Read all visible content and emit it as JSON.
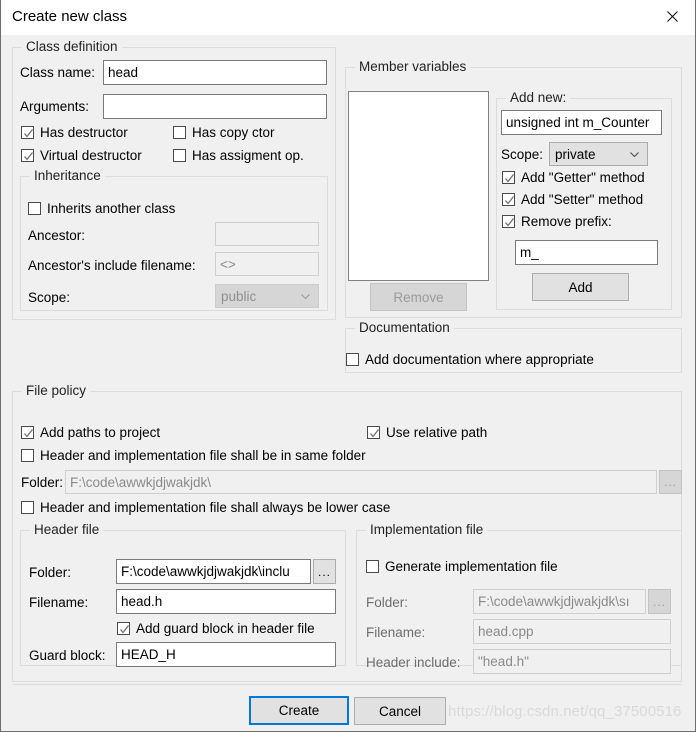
{
  "window": {
    "title": "Create new class",
    "close_icon": "close-icon"
  },
  "class_definition": {
    "legend": "Class definition",
    "class_name_label": "Class name:",
    "class_name_value": "head",
    "arguments_label": "Arguments:",
    "arguments_value": "",
    "has_destructor_label": "Has destructor",
    "has_destructor_checked": true,
    "has_copy_ctor_label": "Has copy ctor",
    "has_copy_ctor_checked": false,
    "virtual_destructor_label": "Virtual destructor",
    "virtual_destructor_checked": true,
    "has_assignment_op_label": "Has assigment op.",
    "has_assignment_op_checked": false,
    "inheritance": {
      "legend": "Inheritance",
      "inherits_label": "Inherits another class",
      "inherits_checked": false,
      "ancestor_label": "Ancestor:",
      "ancestor_value": "",
      "ancestor_include_label": "Ancestor's include filename:",
      "ancestor_include_value": "<>",
      "scope_label": "Scope:",
      "scope_value": "public"
    }
  },
  "member_variables": {
    "legend": "Member variables",
    "list_items": [],
    "remove_label": "Remove",
    "add_new": {
      "legend": "Add new:",
      "declaration_value": "unsigned int m_Counter",
      "scope_label": "Scope:",
      "scope_value": "private",
      "add_getter_label": "Add \"Getter\" method",
      "add_getter_checked": true,
      "add_setter_label": "Add \"Setter\" method",
      "add_setter_checked": true,
      "remove_prefix_label": "Remove prefix:",
      "remove_prefix_checked": true,
      "prefix_value": "m_",
      "add_button_label": "Add"
    }
  },
  "documentation": {
    "legend": "Documentation",
    "add_doc_label": "Add documentation where appropriate",
    "add_doc_checked": false
  },
  "file_policy": {
    "legend": "File policy",
    "add_paths_label": "Add paths to project",
    "add_paths_checked": true,
    "use_relative_label": "Use relative path",
    "use_relative_checked": true,
    "same_folder_label": "Header and implementation file shall be in same folder",
    "same_folder_checked": false,
    "folder_label": "Folder:",
    "folder_value": "F:\\code\\awwkjdjwakjdk\\",
    "browse_label": "...",
    "lower_case_label": "Header and implementation file shall always be lower case",
    "lower_case_checked": false,
    "header_file": {
      "legend": "Header file",
      "folder_label": "Folder:",
      "folder_value": "F:\\code\\awwkjdjwakjdk\\inclu",
      "browse_label": "...",
      "filename_label": "Filename:",
      "filename_value": "head.h",
      "guard_block_check_label": "Add guard block in header file",
      "guard_block_checked": true,
      "guard_block_label": "Guard block:",
      "guard_block_value": "HEAD_H"
    },
    "implementation_file": {
      "legend": "Implementation file",
      "generate_label": "Generate implementation file",
      "generate_checked": false,
      "folder_label": "Folder:",
      "folder_value": "F:\\code\\awwkjdjwakjdk\\sı",
      "browse_label": "...",
      "filename_label": "Filename:",
      "filename_value": "head.cpp",
      "header_include_label": "Header include:",
      "header_include_value": "\"head.h\""
    }
  },
  "footer": {
    "create_label": "Create",
    "cancel_label": "Cancel"
  },
  "watermark": {
    "text": "https://blog.csdn.net/qq_37500516"
  },
  "colors": {
    "accent": "#0078d7",
    "dialog_bg": "#f0f0f0",
    "field_bg": "#ffffff",
    "disabled_text": "#8a8a8a"
  }
}
